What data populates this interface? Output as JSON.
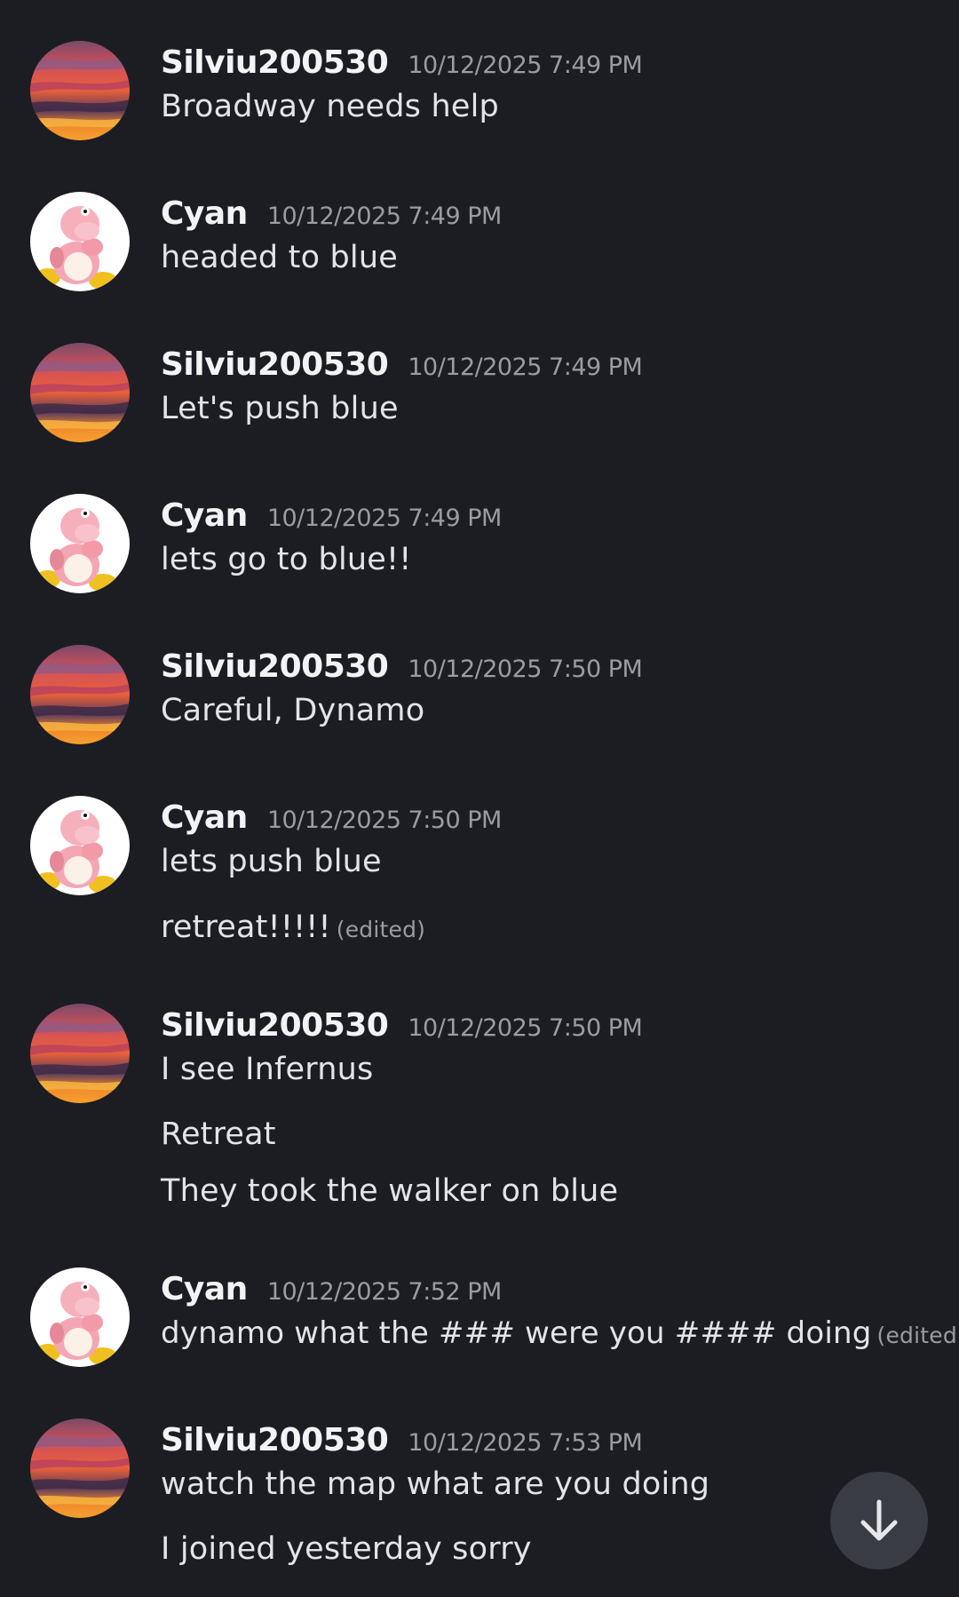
{
  "messages": [
    {
      "user": "Silviu200530",
      "time": "10/12/2025 7:49 PM",
      "avatar": "sunset-avatar",
      "lines": [
        {
          "text": "Broadway needs help",
          "edited": ""
        }
      ]
    },
    {
      "user": "Cyan",
      "time": "10/12/2025 7:49 PM",
      "avatar": "yoshi-plush-avatar",
      "lines": [
        {
          "text": "headed to blue",
          "edited": ""
        }
      ]
    },
    {
      "user": "Silviu200530",
      "time": "10/12/2025 7:49 PM",
      "avatar": "sunset-avatar",
      "lines": [
        {
          "text": "Let's push blue",
          "edited": ""
        }
      ]
    },
    {
      "user": "Cyan",
      "time": "10/12/2025 7:49 PM",
      "avatar": "yoshi-plush-avatar",
      "lines": [
        {
          "text": "lets go to blue!!",
          "edited": ""
        }
      ]
    },
    {
      "user": "Silviu200530",
      "time": "10/12/2025 7:50 PM",
      "avatar": "sunset-avatar",
      "lines": [
        {
          "text": "Careful, Dynamo",
          "edited": ""
        }
      ]
    },
    {
      "user": "Cyan",
      "time": "10/12/2025 7:50 PM",
      "avatar": "yoshi-plush-avatar",
      "lines": [
        {
          "text": "lets push blue",
          "edited": ""
        },
        {
          "text": "retreat!!!!!",
          "edited": "(edited)"
        }
      ]
    },
    {
      "user": "Silviu200530",
      "time": "10/12/2025 7:50 PM",
      "avatar": "sunset-avatar",
      "lines": [
        {
          "text": "I see Infernus",
          "edited": ""
        },
        {
          "text": "Retreat",
          "edited": ""
        },
        {
          "text": "They took the walker on blue",
          "edited": ""
        }
      ]
    },
    {
      "user": "Cyan",
      "time": "10/12/2025 7:52 PM",
      "avatar": "yoshi-plush-avatar",
      "lines": [
        {
          "text": "dynamo what the ### were you ####  doing",
          "edited": "(edited)"
        }
      ]
    },
    {
      "user": "Silviu200530",
      "time": "10/12/2025 7:53 PM",
      "avatar": "sunset-avatar",
      "lines": [
        {
          "text": "watch the map what are you doing",
          "edited": ""
        },
        {
          "text": "I joined yesterday sorry",
          "edited": ""
        }
      ]
    }
  ],
  "scroll_button": {
    "icon": "arrow-down-icon"
  },
  "colors": {
    "background": "#1c1d22",
    "username": "#f2f3f5",
    "timestamp": "#9a9ca4",
    "message_text": "#e3e4e8",
    "scroll_button": "#3a3c44"
  }
}
